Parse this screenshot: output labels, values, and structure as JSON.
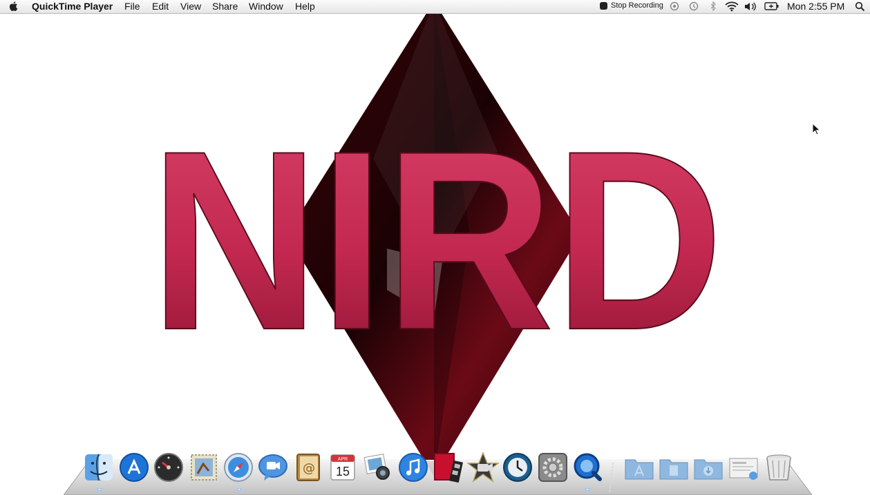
{
  "menubar": {
    "app_name": "QuickTime Player",
    "menus": [
      "File",
      "Edit",
      "View",
      "Share",
      "Window",
      "Help"
    ],
    "stop_recording": "Stop Recording",
    "clock": "Mon 2:55 PM"
  },
  "wallpaper": {
    "logo_text": "NIRD",
    "colors": {
      "letters": "#c2284f",
      "diamond": "#2a0306"
    }
  },
  "dock": {
    "calendar_month": "APR",
    "calendar_day": "15",
    "apps": [
      "finder",
      "app-store",
      "dashboard",
      "mail",
      "safari",
      "ichat",
      "address-book",
      "ical",
      "iphoto",
      "itunes",
      "photo-booth",
      "imovie",
      "time-machine",
      "system-preferences",
      "quicktime"
    ],
    "folders": [
      "applications",
      "documents",
      "downloads"
    ]
  }
}
